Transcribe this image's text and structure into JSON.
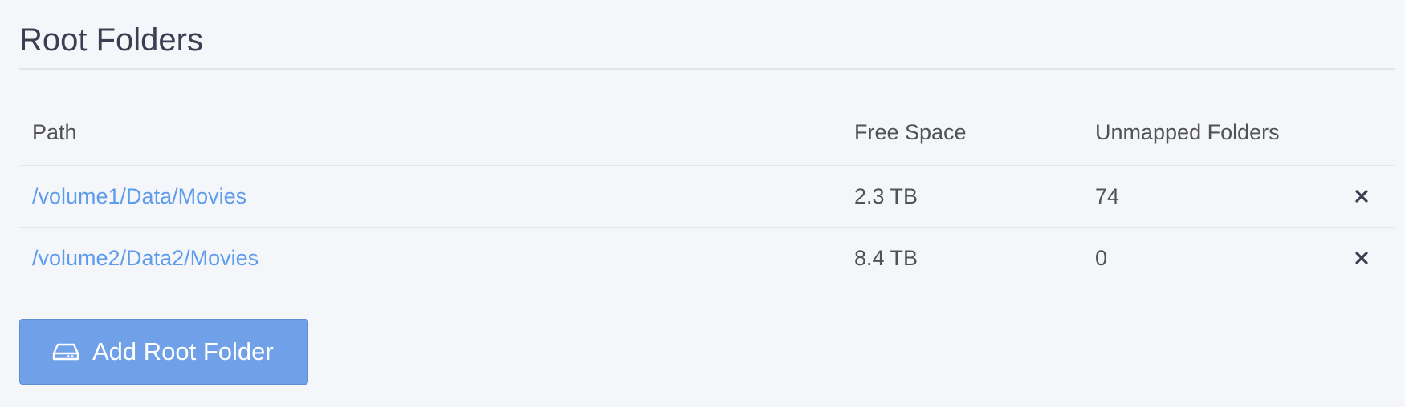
{
  "section": {
    "title": "Root Folders"
  },
  "table": {
    "columns": {
      "path": "Path",
      "free_space": "Free Space",
      "unmapped_folders": "Unmapped Folders"
    },
    "rows": [
      {
        "path": "/volume1/Data/Movies",
        "free_space": "2.3 TB",
        "unmapped_folders": "74",
        "action_icon": "close-icon"
      },
      {
        "path": "/volume2/Data2/Movies",
        "free_space": "8.4 TB",
        "unmapped_folders": "0",
        "action_icon": "close-icon"
      }
    ]
  },
  "add_button": {
    "label": "Add Root Folder",
    "icon": "hard-drive-icon"
  },
  "colors": {
    "link": "#5d9cec",
    "button": "#6fa0e8",
    "background": "#f5f6fa"
  }
}
